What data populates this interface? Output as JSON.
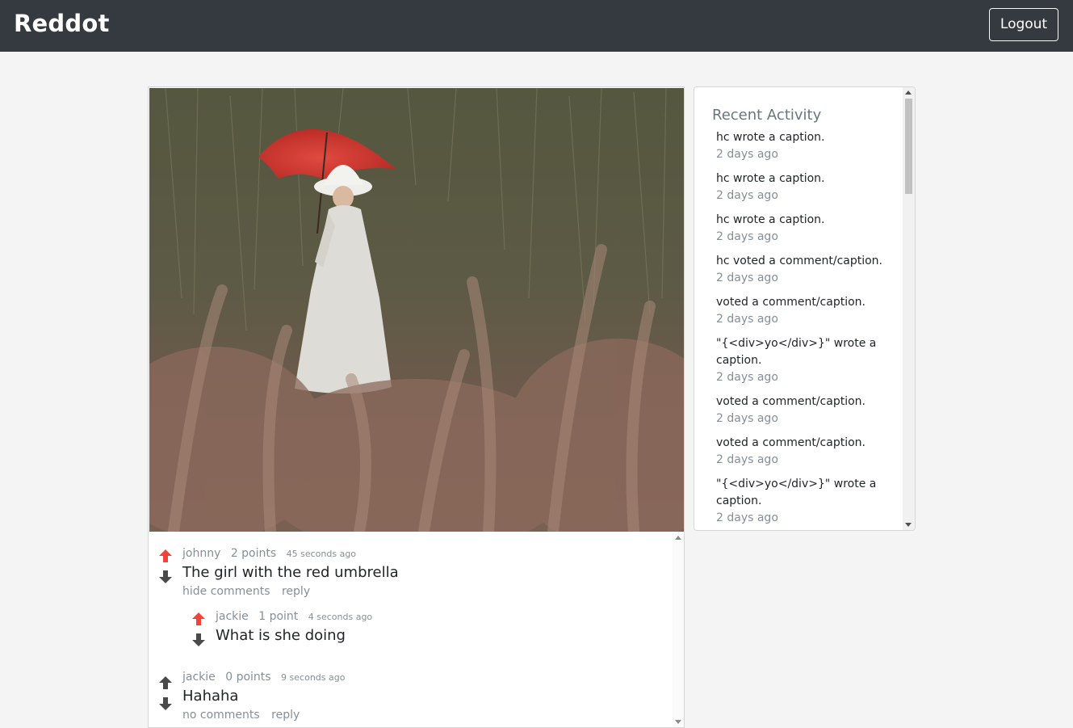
{
  "navbar": {
    "brand": "Reddot",
    "logout_label": "Logout",
    "background": "#343a40"
  },
  "post": {
    "image_subject": "Woman in white dress holding a red umbrella in tall grass"
  },
  "vote_colors": {
    "active_upvote": "#f44336",
    "inactive": "#4a4a4a"
  },
  "comments": [
    {
      "author": "johnny",
      "points": "2 points",
      "time": "45 seconds ago",
      "text": "The girl with the red umbrella",
      "toggle_label": "hide comments",
      "reply_label": "reply",
      "upvoted": true,
      "replies": [
        {
          "author": "jackie",
          "points": "1 point",
          "time": "4 seconds ago",
          "text": "What is she doing",
          "upvoted": true
        }
      ]
    },
    {
      "author": "jackie",
      "points": "0 points",
      "time": "9 seconds ago",
      "text": "Hahaha",
      "toggle_label": "no comments",
      "reply_label": "reply",
      "upvoted": false,
      "replies": []
    }
  ],
  "activity": {
    "title": "Recent Activity",
    "items": [
      {
        "text": "hc wrote a caption.",
        "time": "2 days ago"
      },
      {
        "text": "hc wrote a caption.",
        "time": "2 days ago"
      },
      {
        "text": "hc wrote a caption.",
        "time": "2 days ago"
      },
      {
        "text": "hc voted a comment/caption.",
        "time": "2 days ago"
      },
      {
        "text": "voted a comment/caption.",
        "time": "2 days ago"
      },
      {
        "text": "\"{<div>yo</div>}\" wrote a caption.",
        "time": "2 days ago"
      },
      {
        "text": "voted a comment/caption.",
        "time": "2 days ago"
      },
      {
        "text": "voted a comment/caption.",
        "time": "2 days ago"
      },
      {
        "text": "\"{<div>yo</div>}\" wrote a caption.",
        "time": "2 days ago"
      }
    ]
  }
}
